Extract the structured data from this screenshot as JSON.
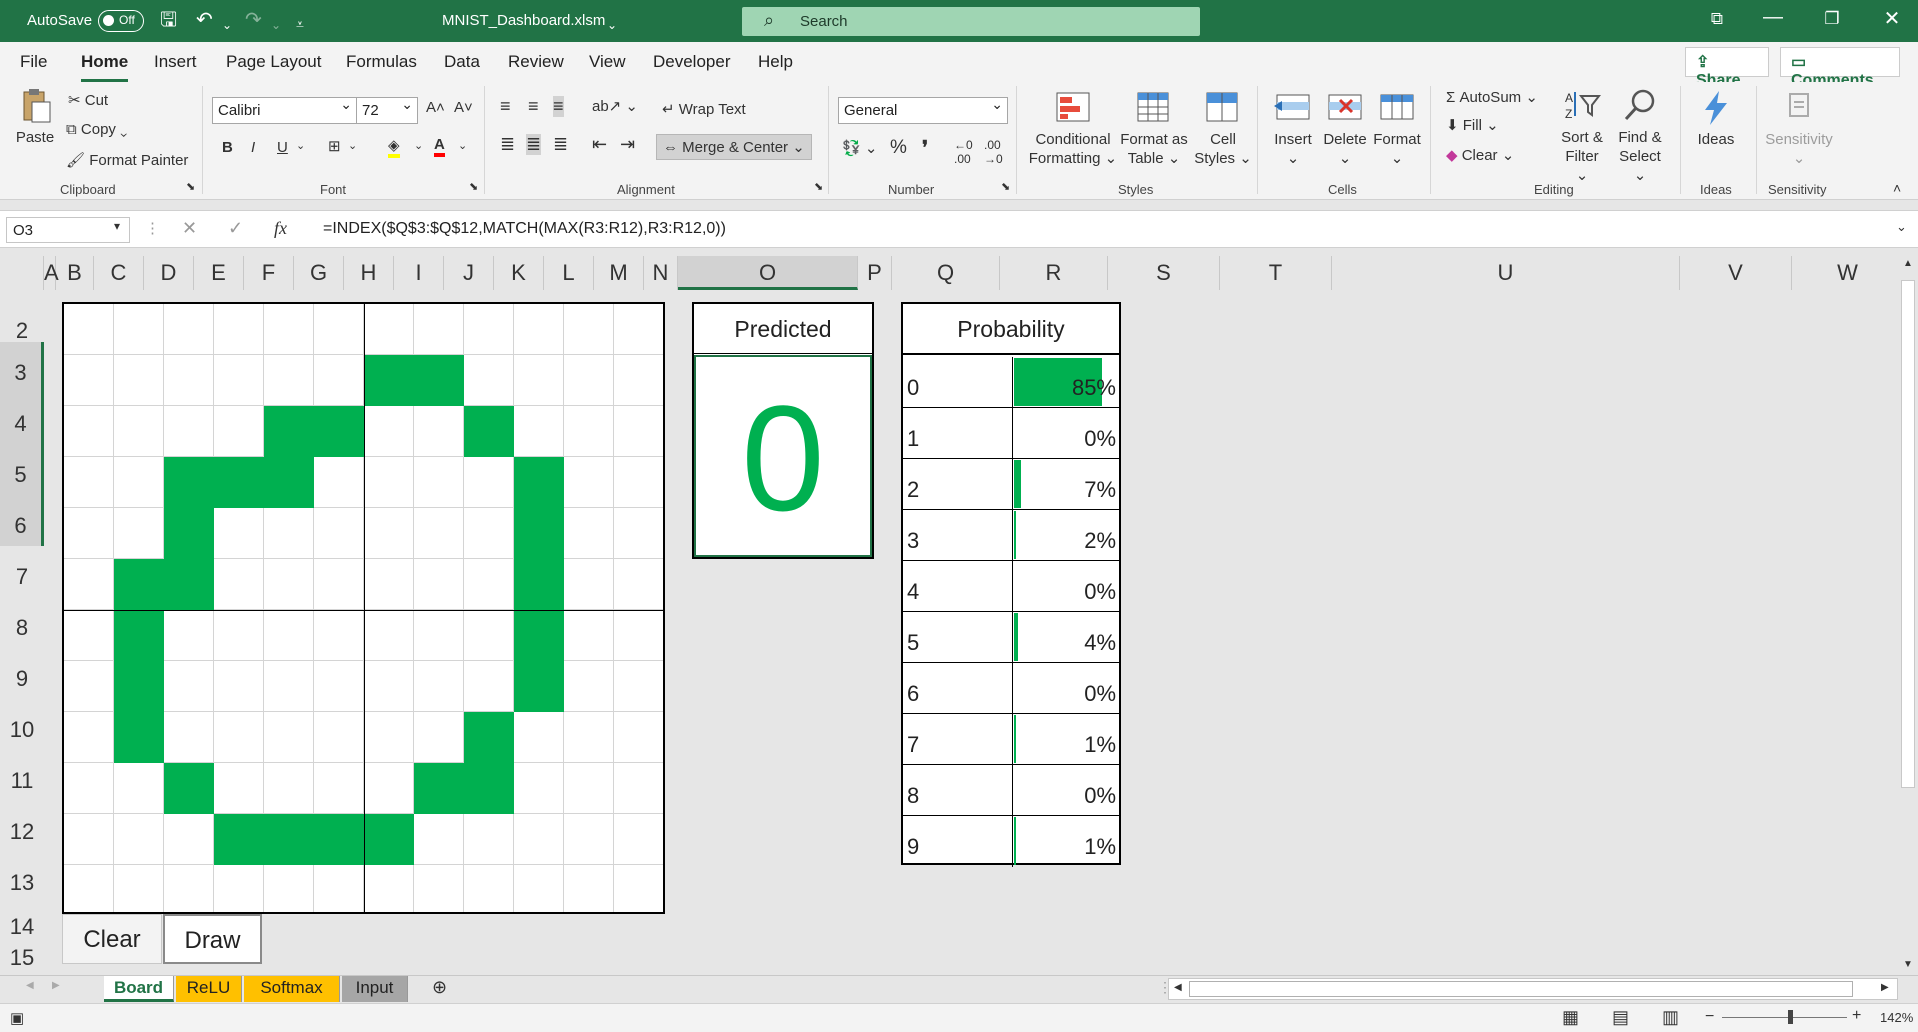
{
  "titlebar": {
    "autosave_label": "AutoSave",
    "autosave_state": "Off",
    "filename": "MNIST_Dashboard.xlsm",
    "search_placeholder": "Search"
  },
  "ribbon_tabs": [
    "File",
    "Home",
    "Insert",
    "Page Layout",
    "Formulas",
    "Data",
    "Review",
    "View",
    "Developer",
    "Help"
  ],
  "active_tab": "Home",
  "share_label": "Share",
  "comments_label": "Comments",
  "ribbon": {
    "clipboard": {
      "paste": "Paste",
      "cut": "Cut",
      "copy": "Copy",
      "format_painter": "Format Painter",
      "group": "Clipboard"
    },
    "font": {
      "name": "Calibri",
      "size": "72",
      "group": "Font",
      "bold": "B",
      "italic": "I",
      "underline": "U"
    },
    "alignment": {
      "wrap": "Wrap Text",
      "merge": "Merge & Center",
      "group": "Alignment"
    },
    "number": {
      "format": "General",
      "group": "Number",
      "percent": "%",
      "comma": "❜"
    },
    "styles": {
      "cond1": "Conditional",
      "cond2": "Formatting",
      "table1": "Format as",
      "table2": "Table",
      "cell1": "Cell",
      "cell2": "Styles",
      "group": "Styles"
    },
    "cells": {
      "insert": "Insert",
      "delete": "Delete",
      "format": "Format",
      "group": "Cells"
    },
    "editing": {
      "autosum": "AutoSum",
      "fill": "Fill",
      "clear": "Clear",
      "sort1": "Sort &",
      "sort2": "Filter",
      "find1": "Find &",
      "find2": "Select",
      "group": "Editing"
    },
    "ideas": {
      "label": "Ideas",
      "group": "Ideas"
    },
    "sensitivity": {
      "label": "Sensitivity",
      "group": "Sensitivity"
    }
  },
  "formula_bar": {
    "name_box": "O3",
    "fx": "fx",
    "formula": "=INDEX($Q$3:$Q$12,MATCH(MAX(R3:R12),R3:R12,0))"
  },
  "columns": [
    "A",
    "B",
    "C",
    "D",
    "E",
    "F",
    "G",
    "H",
    "I",
    "J",
    "K",
    "L",
    "M",
    "N",
    "O",
    "P",
    "Q",
    "R",
    "S",
    "T",
    "U",
    "V",
    "W"
  ],
  "selected_column": "O",
  "rows": [
    "2",
    "3",
    "4",
    "5",
    "6",
    "7",
    "8",
    "9",
    "10",
    "11",
    "12",
    "13",
    "14",
    "15"
  ],
  "selected_rows": [
    "3",
    "4",
    "5",
    "6"
  ],
  "board": {
    "cols": 12,
    "rows": 12,
    "pixels": [
      "000000000000",
      "000000110000",
      "000011001000",
      "002110000100",
      "001000000100",
      "011000000100",
      "010000000100",
      "010000000100",
      "010000001000",
      "001000011000",
      "000111100000",
      "000000000000"
    ],
    "fill_color": "#00b050"
  },
  "predicted": {
    "title": "Predicted",
    "value": "0",
    "color": "#00b050"
  },
  "probability": {
    "title": "Probability",
    "rows": [
      {
        "digit": "0",
        "pct": "85%",
        "value": 0.85
      },
      {
        "digit": "1",
        "pct": "0%",
        "value": 0.0
      },
      {
        "digit": "2",
        "pct": "7%",
        "value": 0.07
      },
      {
        "digit": "3",
        "pct": "2%",
        "value": 0.02
      },
      {
        "digit": "4",
        "pct": "0%",
        "value": 0.0
      },
      {
        "digit": "5",
        "pct": "4%",
        "value": 0.04
      },
      {
        "digit": "6",
        "pct": "0%",
        "value": 0.0
      },
      {
        "digit": "7",
        "pct": "1%",
        "value": 0.01
      },
      {
        "digit": "8",
        "pct": "0%",
        "value": 0.0
      },
      {
        "digit": "9",
        "pct": "1%",
        "value": 0.01
      }
    ]
  },
  "buttons": {
    "clear": "Clear",
    "draw": "Draw"
  },
  "sheets": [
    {
      "name": "Board",
      "color": "#ffffff",
      "active": true
    },
    {
      "name": "ReLU",
      "color": "#ffc000",
      "active": false
    },
    {
      "name": "Softmax",
      "color": "#ffc000",
      "active": false
    },
    {
      "name": "Input",
      "color": "#a6a6a6",
      "active": false
    }
  ],
  "status": {
    "zoom": "142%"
  }
}
